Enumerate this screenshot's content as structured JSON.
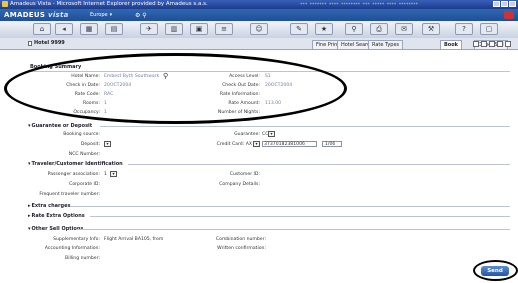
{
  "window": {
    "title": "Amadeus Vista - Microsoft Internet Explorer provided by Amadeus s.a.s.",
    "status_text": "*** ******* **** ******** *** ***** **** ********"
  },
  "app": {
    "brand": "AMADEUS",
    "product": "vista",
    "user": "Europe"
  },
  "tabs": {
    "doc_label": "Hotel 9999",
    "items": [
      "Fine Print",
      "Hotel Search",
      "Rate Types",
      "Book",
      "Direct Sell"
    ],
    "active": "Book"
  },
  "booking_summary": {
    "title": "Booking Summary",
    "hotel_name_label": "Hotel Name:",
    "hotel_name_value": "Embest Byth Southwark",
    "access_level_label": "Access Level:",
    "access_level_value": "S1",
    "check_in_label": "Check in Date:",
    "check_in_value": "20OCT2004",
    "check_out_label": "Check Out Date:",
    "check_out_value": "20OCT2004",
    "rate_code_label": "Rate Code:",
    "rate_code_value": "RAC",
    "rate_information_label": "Rate Information:",
    "rooms_label": "Rooms:",
    "rooms_value": "1",
    "rate_amount_label": "Rate Amount:",
    "rate_amount_value": "113.00",
    "occupancy_label": "Occupancy:",
    "occupancy_value": "1",
    "nights_label": "Number of Nights:"
  },
  "guarantee": {
    "title": "Guarantee or Deposit",
    "booking_source_label": "Booking source:",
    "guarantee_label": "Guarantee:",
    "guarantee_value": "CC",
    "deposit_label": "Deposit:",
    "credit_card_label": "Credit Card: AX",
    "credit_card_number": "37370182381006",
    "expiry": "1/06",
    "ncc_label": "NCC Number:"
  },
  "traveler": {
    "title": "Traveler/Customer Identification",
    "passenger_label": "Passenger association:",
    "passenger_value": "1",
    "customer_id_label": "Customer ID:",
    "corporate_id_label": "Corporate ID:",
    "company_details_label": "Company Details:",
    "frequent_traveler_label": "Frequent traveler number:"
  },
  "collapsed_sections": [
    "Extra charges",
    "Rate Extra Options"
  ],
  "other_options": {
    "title": "Other Sell Options",
    "supplementary_label": "Supplementary Info:",
    "supplementary_value": "Flight Arrival BA105, from",
    "combination_label": "Combination number:",
    "accounting_label": "Accounting Information:",
    "written_confirmation_label": "Written confirmation:",
    "billing_label": "Billing number:"
  },
  "send_label": "Send",
  "colors": {
    "title_bar": "#1b3c8f",
    "send_button": "#2456a6"
  }
}
